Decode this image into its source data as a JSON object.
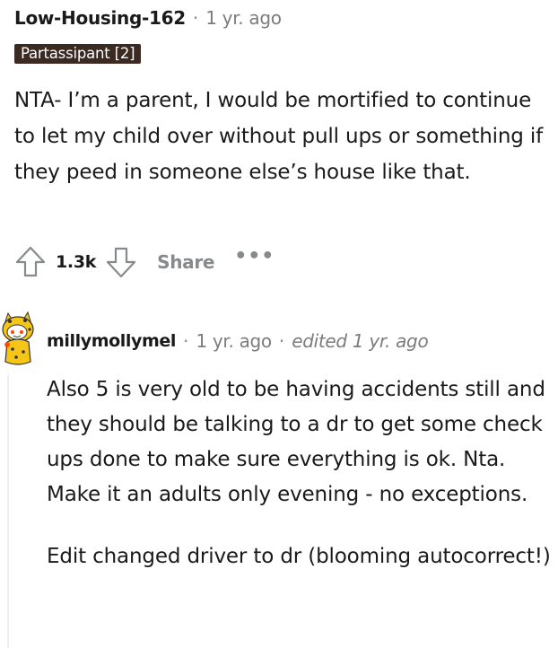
{
  "comment": {
    "author": "Low-Housing-162",
    "separator": "·",
    "time": "1 yr. ago",
    "flair": "Partassipant [2]",
    "body": "NTA- I’m a parent, I would be mortified to continue to let my child over without pull ups or something if they peed in someone else’s house like that.",
    "actions": {
      "upvote_icon": "upvote-arrow-icon",
      "score": "1.3k",
      "downvote_icon": "downvote-arrow-icon",
      "share": "Share",
      "more": "•••"
    }
  },
  "reply": {
    "avatar_icon": "snoo-avatar-icon",
    "author": "millymollymel",
    "separator": "·",
    "time": "1 yr. ago",
    "edited": "edited 1 yr. ago",
    "paragraphs": [
      "Also 5 is very old to be having accidents still and they should be talking to a dr to get some check ups done to make sure everything is ok. Nta. Make it an adults only evening - no exceptions.",
      "Edit changed driver to dr (blooming autocorrect!)"
    ]
  },
  "colors": {
    "flair_bg": "#3b2a22",
    "meta_gray": "#7c7c7c",
    "icon_gray": "#878a8c"
  }
}
